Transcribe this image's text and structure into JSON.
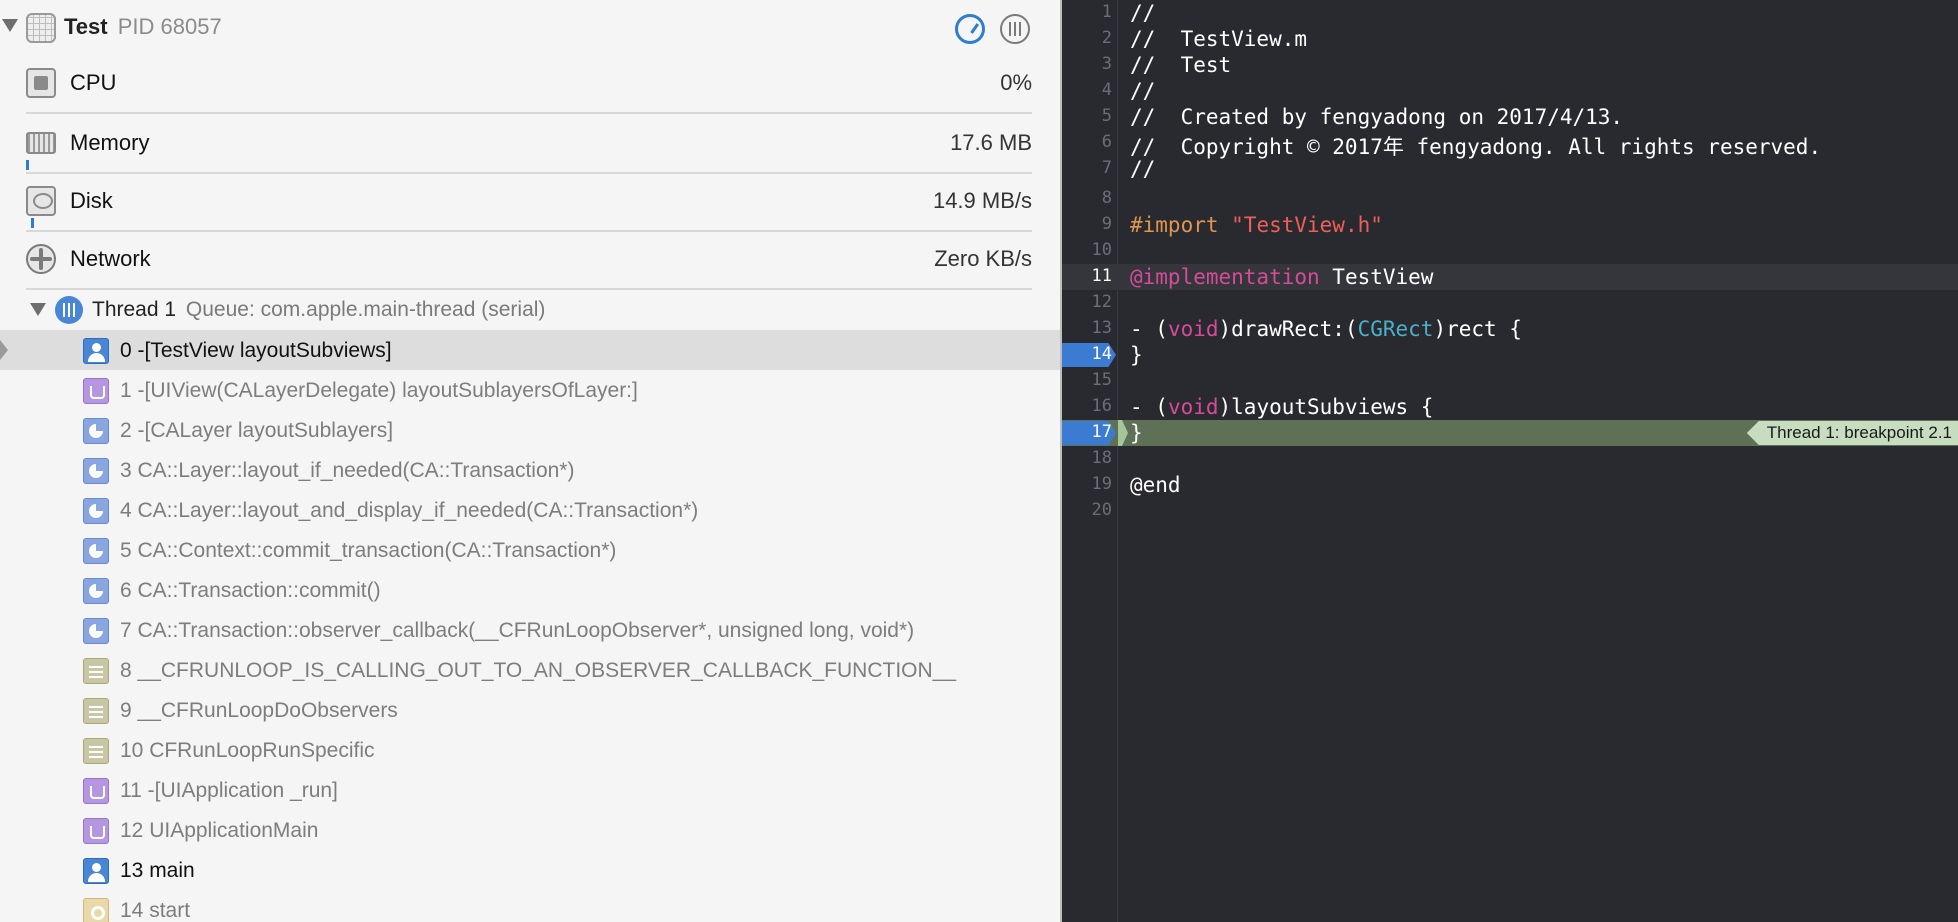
{
  "process": {
    "name": "Test",
    "pid": "PID 68057"
  },
  "gauges": [
    {
      "label": "CPU",
      "value": "0%"
    },
    {
      "label": "Memory",
      "value": "17.6 MB"
    },
    {
      "label": "Disk",
      "value": "14.9 MB/s"
    },
    {
      "label": "Network",
      "value": "Zero KB/s"
    }
  ],
  "thread": {
    "title": "Thread 1",
    "queue": "Queue: com.apple.main-thread (serial)"
  },
  "frames": [
    {
      "text": "0 -[TestView layoutSubviews]",
      "icon": "user-icon",
      "selected": true
    },
    {
      "text": "1 -[UIView(CALayerDelegate) layoutSublayersOfLayer:]",
      "icon": "cup-icon"
    },
    {
      "text": "2 -[CALayer layoutSublayers]",
      "icon": "pie-icon"
    },
    {
      "text": "3 CA::Layer::layout_if_needed(CA::Transaction*)",
      "icon": "pie-icon"
    },
    {
      "text": "4 CA::Layer::layout_and_display_if_needed(CA::Transaction*)",
      "icon": "pie-icon"
    },
    {
      "text": "5 CA::Context::commit_transaction(CA::Transaction*)",
      "icon": "pie-icon"
    },
    {
      "text": "6 CA::Transaction::commit()",
      "icon": "pie-icon"
    },
    {
      "text": "7 CA::Transaction::observer_callback(__CFRunLoopObserver*, unsigned long, void*)",
      "icon": "pie-icon"
    },
    {
      "text": "8 __CFRUNLOOP_IS_CALLING_OUT_TO_AN_OBSERVER_CALLBACK_FUNCTION__",
      "icon": "lines-icon"
    },
    {
      "text": "9 __CFRunLoopDoObservers",
      "icon": "lines-icon"
    },
    {
      "text": "10 CFRunLoopRunSpecific",
      "icon": "lines-icon"
    },
    {
      "text": "11 -[UIApplication _run]",
      "icon": "cup-icon"
    },
    {
      "text": "12 UIApplicationMain",
      "icon": "cup-icon"
    },
    {
      "text": "13 main",
      "icon": "user-icon"
    },
    {
      "text": "14 start",
      "icon": "gear-icon"
    }
  ],
  "editor": {
    "line_numbers": [
      "1",
      "2",
      "3",
      "4",
      "5",
      "6",
      "7",
      "8",
      "9",
      "10",
      "11",
      "12",
      "13",
      "14",
      "15",
      "16",
      "17",
      "18",
      "19",
      "20"
    ],
    "lines": {
      "l1": "//",
      "l2": "//  TestView.m",
      "l3": "//  Test",
      "l4": "//",
      "l5": "//  Created by fengyadong on 2017/4/13.",
      "l6": "//  Copyright © 2017年 fengyadong. All rights reserved.",
      "l7": "//",
      "l9_a": "#import ",
      "l9_b": "\"TestView.h\"",
      "l11_a": "@implementation",
      "l11_b": " TestView",
      "l13_a": "- (",
      "l13_b": "void",
      "l13_c": ")drawRect:(",
      "l13_d": "CGRect",
      "l13_e": ")rect {",
      "l14": "}",
      "l16_a": "- (",
      "l16_b": "void",
      "l16_c": ")layoutSubviews {",
      "l17": "}",
      "l19": "@end"
    },
    "breakpoint_label": "Thread 1: breakpoint 2.1",
    "colors": {
      "background": "#292a30",
      "comment": "#6ab84f",
      "keyword": "#d54b9a",
      "string": "#ef5f58",
      "preprocessor": "#e0954e",
      "type": "#4bb0c9"
    }
  }
}
